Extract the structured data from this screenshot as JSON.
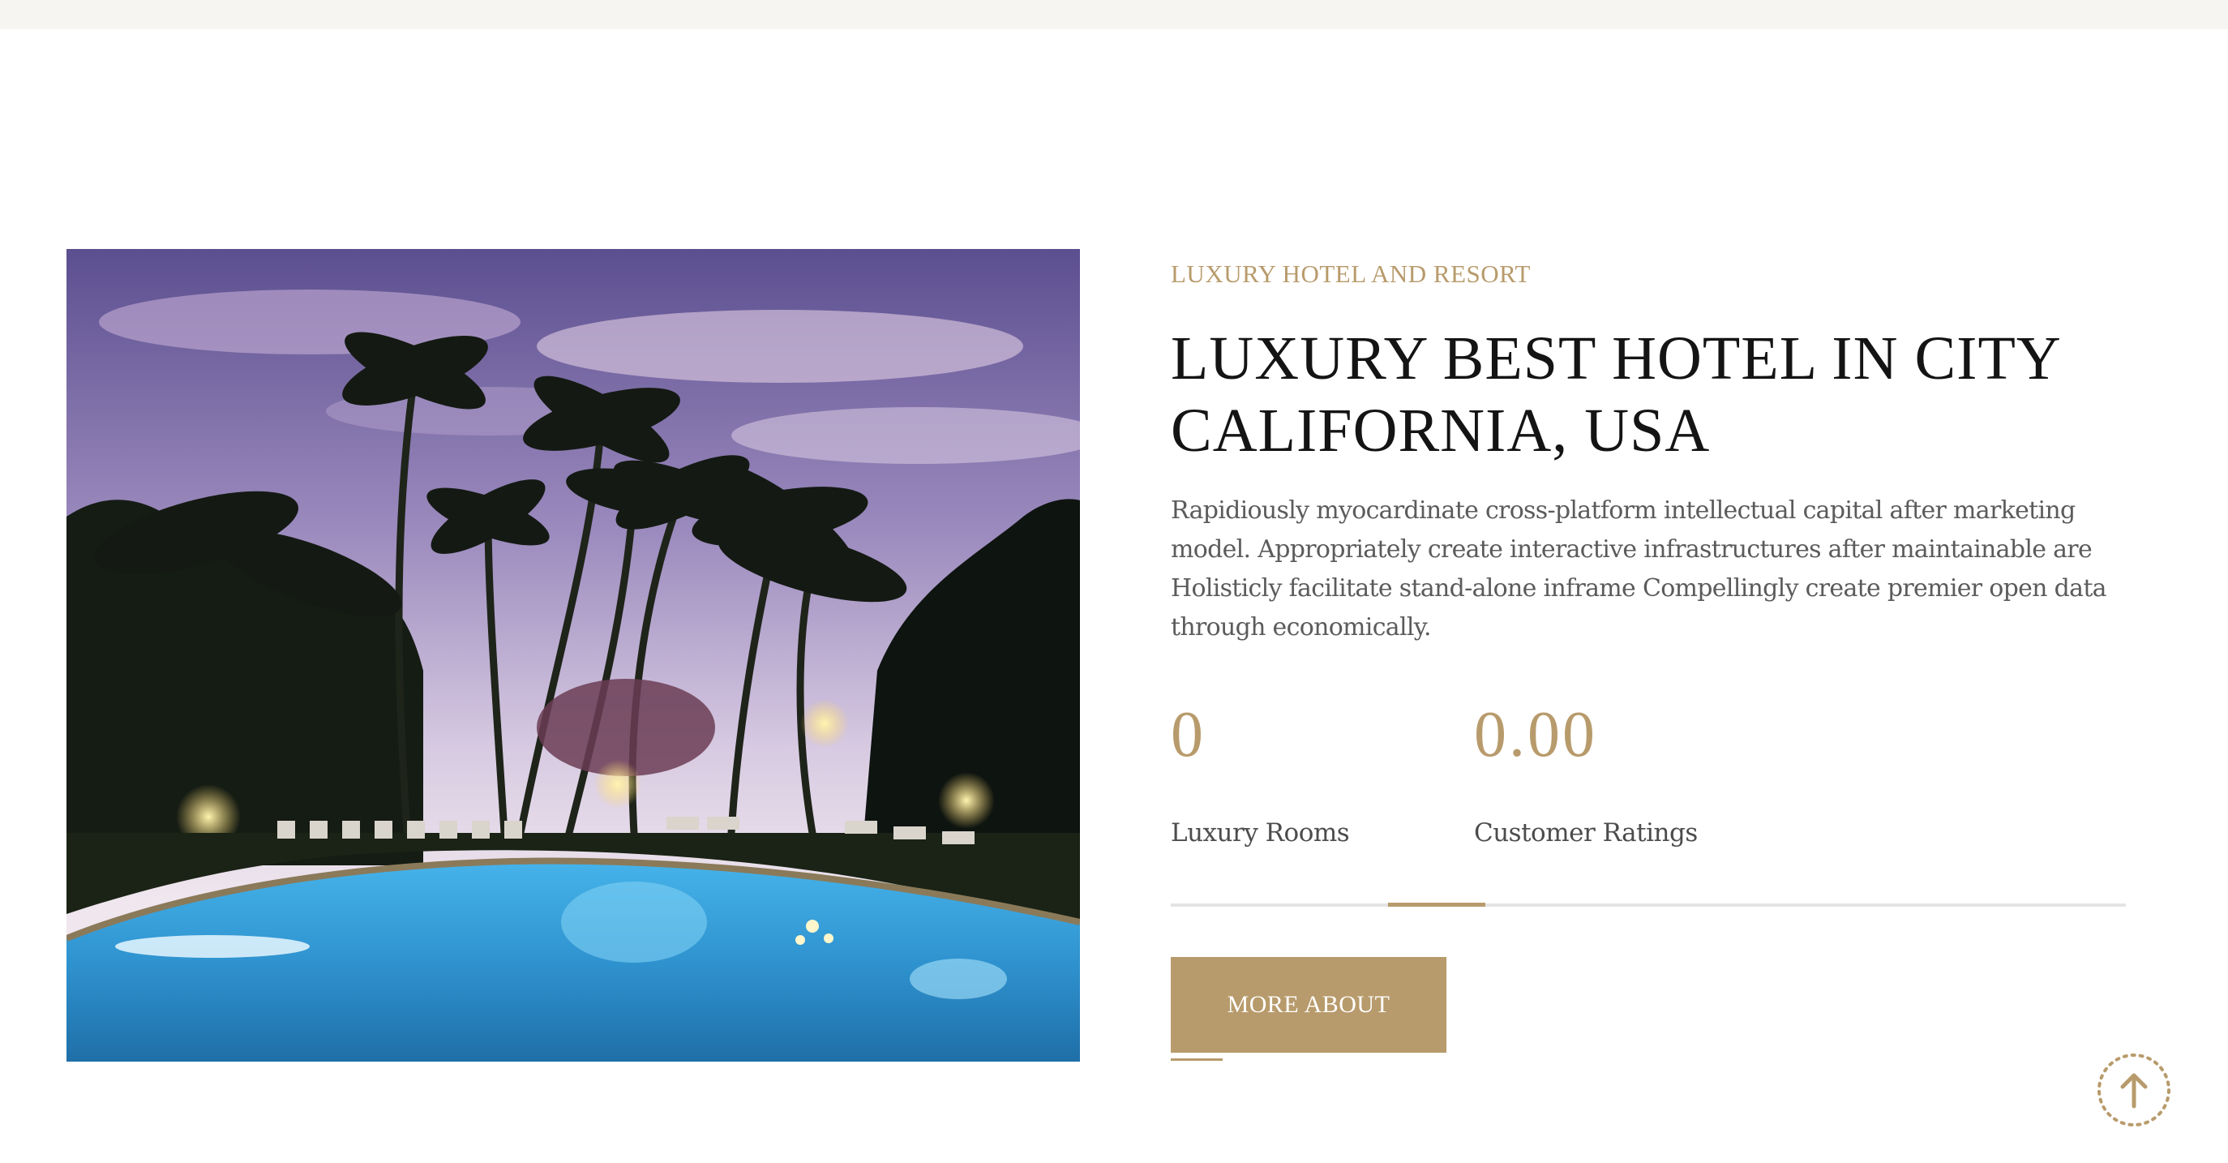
{
  "about": {
    "subtitle": "LUXURY HOTEL AND RESORT",
    "heading": "LUXURY BEST HOTEL IN CITY CALIFORNIA, USA",
    "description": "Rapidiously myocardinate cross-platform intellectual capital after marketing model. Appropriately create interactive infrastructures after maintainable are Holisticly facilitate stand-alone inframe Compellingly create premier open data through economically.",
    "stats": [
      {
        "value": "0",
        "label": "Luxury Rooms"
      },
      {
        "value": "0.00",
        "label": "Customer Ratings"
      }
    ],
    "button_label": "MORE ABOUT"
  },
  "icons": {
    "scroll_top": "arrow-up-icon"
  },
  "colors": {
    "accent": "#b89b6c",
    "heading": "#141414",
    "body_text": "#5b5b5b",
    "top_strip": "#f6f5f1",
    "divider": "#e4e4e4"
  }
}
